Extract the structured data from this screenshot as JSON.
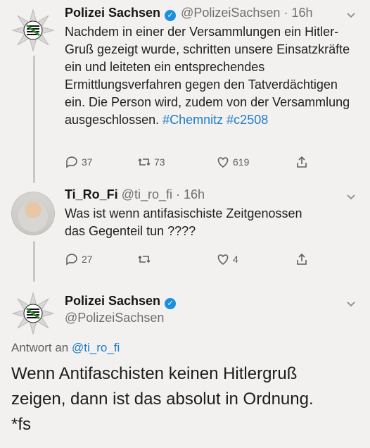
{
  "tweet1": {
    "name": "Polizei Sachsen",
    "handle": "@PolizeiSachsen",
    "time": "· 16h",
    "text": "Nachdem in einer der Versammlungen ein Hitler-Gruß gezeigt wurde, schritten unsere Einsatzkräfte ein und leiteten ein entsprechendes Ermittlungsverfahren gegen den Tatverdächtigen ein. Die Person wird, zudem von der Versammlung ausgeschlossen.",
    "hashtags": [
      "#Chemnitz",
      "#c2508"
    ],
    "replies": "37",
    "retweets": "73",
    "likes": "619"
  },
  "tweet2": {
    "name": "Ti_Ro_Fi",
    "handle": "@ti_ro_fi",
    "time": "· 16h",
    "line1": "Was ist wenn antifasischiste Zeitgenossen",
    "line2": "das Gegenteil tun ????",
    "replies": "27",
    "retweets": "",
    "likes": "4"
  },
  "tweet3": {
    "name": "Polizei Sachsen",
    "handle": "@PolizeiSachsen",
    "reply_prefix": "Antwort an",
    "reply_link": "@ti_ro_fi",
    "text_line1": "Wenn Antifaschisten keinen Hitlergruß",
    "text_line2": "zeigen, dann ist das absolut in Ordnung.",
    "text_line3": "*fs"
  },
  "icons": [
    "police-star-icon",
    "verified-badge-icon",
    "chevron-down-icon",
    "reply-icon",
    "retweet-icon",
    "like-icon",
    "share-icon"
  ],
  "colors": {
    "link": "#1d7ec8",
    "verified": "#1c8fe0",
    "background": "#f2f1ef"
  }
}
